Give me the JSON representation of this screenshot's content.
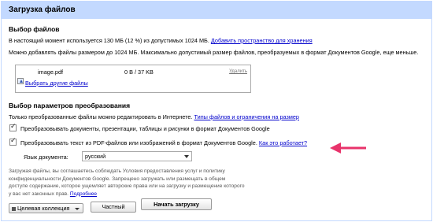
{
  "dialog": {
    "title": "Загрузка файлов"
  },
  "select_files": {
    "heading": "Выбор файлов",
    "usage_text": "В настоящий момент используется 130 МБ (12 %) из допустимых 1024 МБ.",
    "add_space_link": "Добавить пространство для хранения",
    "limit_text": "Можно добавлять файлы размером до 1024 МБ. Максимально допустимый размер файлов, преобразуемых в формат Документов Google, еще меньше.",
    "file": {
      "name": "image.pdf",
      "size": "0 B / 37 KB",
      "delete_label": "Удалить"
    },
    "choose_more_link": "Выбрать другие файлы"
  },
  "conversion": {
    "heading": "Выбор параметров преобразования",
    "note_text": "Только преобразованные файлы можно редактировать в Интернете.",
    "types_link": "Типы файлов и ограничения на размер",
    "convert_docs_label": "Преобразовывать документы, презентации, таблицы и рисунки в формат Документов Google",
    "convert_ocr_label": "Преобразовывать текст из PDF-файлов или изображений в формат Документов Google.",
    "how_link": "Как это работает?",
    "language_label": "Язык документа:",
    "language_value": "русский"
  },
  "terms": {
    "text": "Загружая файлы, вы соглашаетесь соблюдать Условия предоставления услуг и политику конфиденциальности Документов Google. Запрещено загружать или размещать в общем доступе содержание, которое ущемляет авторские права или на загрузку и размещение которого у вас нет законных прав.",
    "more_link": "Подробнее"
  },
  "buttons": {
    "collection": "Целевая коллекция",
    "private": "Частный",
    "start": "Начать загрузку"
  },
  "colors": {
    "titlebar": "#c3d9ff",
    "link": "#0000cc",
    "annotation_arrow": "#e8336b"
  }
}
